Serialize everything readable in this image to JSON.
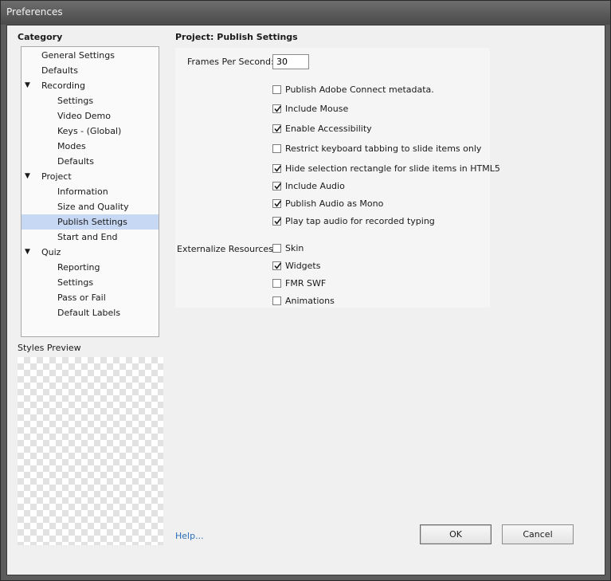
{
  "window": {
    "title": "Preferences"
  },
  "category": {
    "heading": "Category",
    "items": [
      {
        "label": "General Settings",
        "level": 0,
        "expandable": false,
        "selected": false
      },
      {
        "label": "Defaults",
        "level": 0,
        "expandable": false,
        "selected": false
      },
      {
        "label": "Recording",
        "level": 0,
        "expandable": true,
        "selected": false
      },
      {
        "label": "Settings",
        "level": 1,
        "expandable": false,
        "selected": false
      },
      {
        "label": "Video Demo",
        "level": 1,
        "expandable": false,
        "selected": false
      },
      {
        "label": "Keys - (Global)",
        "level": 1,
        "expandable": false,
        "selected": false
      },
      {
        "label": "Modes",
        "level": 1,
        "expandable": false,
        "selected": false
      },
      {
        "label": "Defaults",
        "level": 1,
        "expandable": false,
        "selected": false
      },
      {
        "label": "Project",
        "level": 0,
        "expandable": true,
        "selected": false
      },
      {
        "label": "Information",
        "level": 1,
        "expandable": false,
        "selected": false
      },
      {
        "label": "Size and Quality",
        "level": 1,
        "expandable": false,
        "selected": false
      },
      {
        "label": "Publish Settings",
        "level": 1,
        "expandable": false,
        "selected": true
      },
      {
        "label": "Start and End",
        "level": 1,
        "expandable": false,
        "selected": false
      },
      {
        "label": "Quiz",
        "level": 0,
        "expandable": true,
        "selected": false
      },
      {
        "label": "Reporting",
        "level": 1,
        "expandable": false,
        "selected": false
      },
      {
        "label": "Settings",
        "level": 1,
        "expandable": false,
        "selected": false
      },
      {
        "label": "Pass or Fail",
        "level": 1,
        "expandable": false,
        "selected": false
      },
      {
        "label": "Default Labels",
        "level": 1,
        "expandable": false,
        "selected": false
      }
    ],
    "expand_icon": "triangle-down-icon"
  },
  "styles_preview": {
    "label": "Styles Preview"
  },
  "section": {
    "title": "Project: Publish Settings"
  },
  "fps": {
    "label": "Frames Per Second:",
    "value": "30"
  },
  "options": [
    {
      "label": "Publish Adobe Connect metadata.",
      "checked": false
    },
    {
      "label": "Include Mouse",
      "checked": true
    },
    {
      "label": "Enable Accessibility",
      "checked": true
    },
    {
      "label": "Restrict keyboard tabbing to slide items only",
      "checked": false
    },
    {
      "label": "Hide selection rectangle for slide items in HTML5",
      "checked": true
    },
    {
      "label": "Include Audio",
      "checked": true
    },
    {
      "label": "Publish Audio as Mono",
      "checked": true
    },
    {
      "label": "Play tap audio for recorded typing",
      "checked": true
    }
  ],
  "externalize": {
    "label": "Externalize Resources:",
    "items": [
      {
        "label": "Skin",
        "checked": false
      },
      {
        "label": "Widgets",
        "checked": true
      },
      {
        "label": "FMR SWF",
        "checked": false
      },
      {
        "label": "Animations",
        "checked": false
      }
    ]
  },
  "footer": {
    "help": "Help...",
    "ok": "OK",
    "cancel": "Cancel"
  },
  "colors": {
    "selection": "#c6d8f4",
    "link": "#2a6eb8"
  }
}
